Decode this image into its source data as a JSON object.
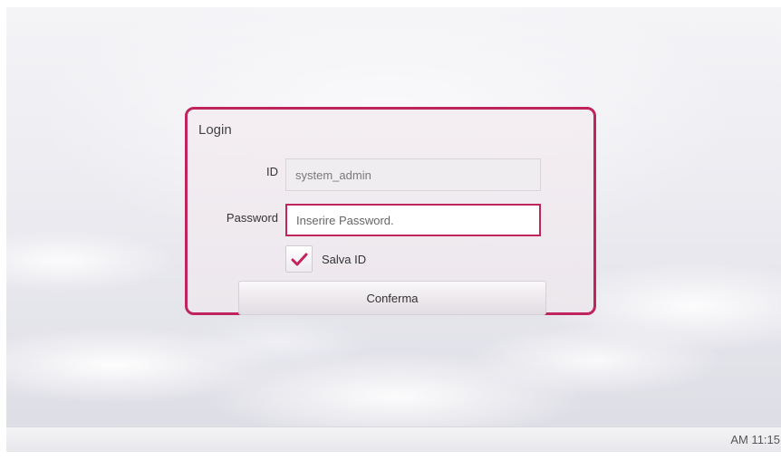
{
  "login": {
    "title": "Login",
    "id_label": "ID",
    "id_value": "system_admin",
    "password_label": "Password",
    "password_placeholder": "Inserire Password.",
    "save_id_label": "Salva ID",
    "save_id_checked": true,
    "confirm_label": "Conferma"
  },
  "status_bar": {
    "clock": "AM 11:15"
  },
  "colors": {
    "accent": "#c0245c",
    "check": "#c0245c"
  }
}
